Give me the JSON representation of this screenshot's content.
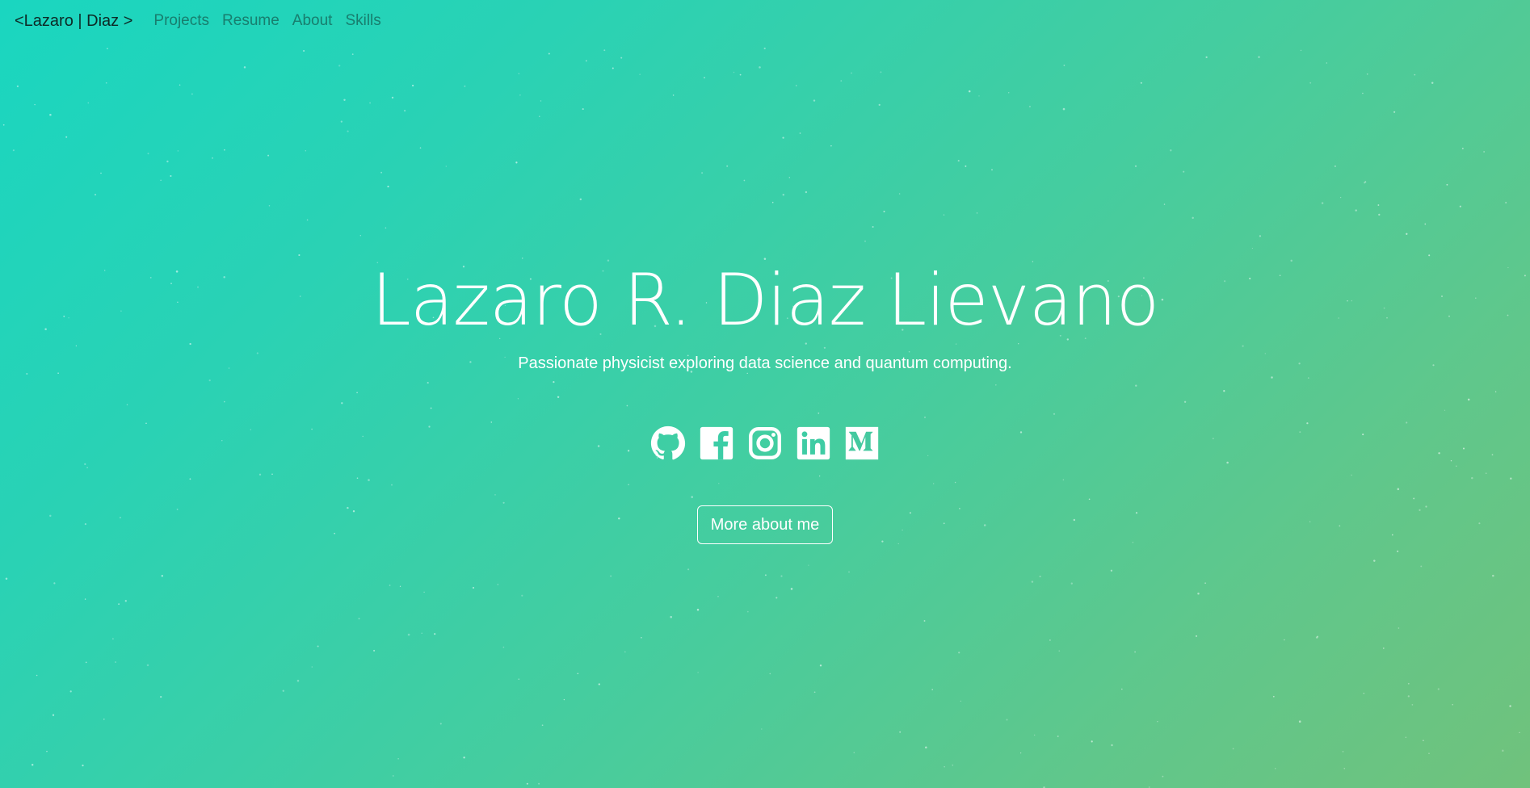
{
  "navbar": {
    "brand": "<Lazaro | Diaz >",
    "links": [
      "Projects",
      "Resume",
      "About",
      "Skills"
    ]
  },
  "hero": {
    "title": "Lazaro R. Diaz Lievano",
    "subtitle": "Passionate physicist exploring data science and quantum computing.",
    "button_label": "More about me"
  },
  "social_icons": [
    "github-icon",
    "facebook-icon",
    "instagram-icon",
    "linkedin-icon",
    "medium-icon"
  ],
  "colors": {
    "gradient_start": "#1ad6c0",
    "gradient_end": "#70c27c",
    "brand_text": "#0d2a26",
    "nav_link": "#187e6e",
    "text": "#ffffff"
  }
}
